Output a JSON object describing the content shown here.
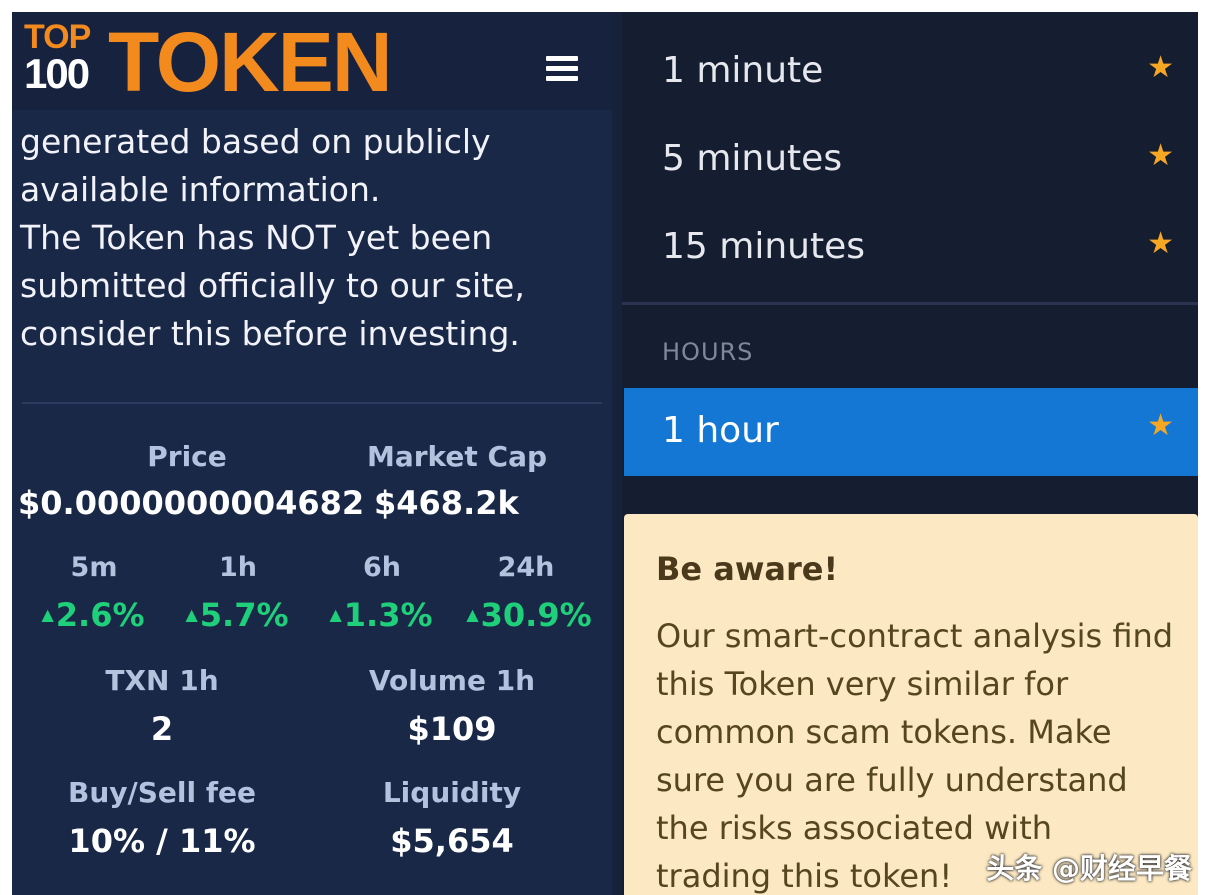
{
  "header": {
    "logo_top": "TOP",
    "logo_100": "100",
    "logo_token": "TOKEN"
  },
  "notice": {
    "text": "generated based on publicly available information.\nThe Token has NOT yet been submitted officially to our site, consider this before investing."
  },
  "stats": {
    "price_label": "Price",
    "price_value": "$0.0000000004682",
    "market_cap_label": "Market Cap",
    "market_cap_value": "$468.2k",
    "changes": [
      {
        "label": "5m",
        "value": "2.6%"
      },
      {
        "label": "1h",
        "value": "5.7%"
      },
      {
        "label": "6h",
        "value": "1.3%"
      },
      {
        "label": "24h",
        "value": "30.9%"
      }
    ],
    "txn_label": "TXN 1h",
    "txn_value": "2",
    "volume_label": "Volume 1h",
    "volume_value": "$109",
    "fee_label": "Buy/Sell fee",
    "fee_value": "10% / 11%",
    "liquidity_label": "Liquidity",
    "liquidity_value": "$5,654"
  },
  "timeframes": {
    "minutes": [
      {
        "label": "1 minute"
      },
      {
        "label": "5 minutes"
      },
      {
        "label": "15 minutes"
      }
    ],
    "hours_heading": "HOURS",
    "hours": [
      {
        "label": "1 hour",
        "selected": true
      }
    ]
  },
  "warning": {
    "title": "Be aware!",
    "body": "Our smart-contract analysis find this Token very similar for common scam tokens. Make sure you are fully understand the risks associated with trading this token!"
  },
  "watermark": "头条 @财经早餐",
  "colors": {
    "brand_orange": "#f28a1e",
    "positive_green": "#1fd07a",
    "selected_blue": "#1477d4",
    "star_gold": "#f5a623",
    "warning_bg": "#fce9c3"
  },
  "icons": {
    "menu": "hamburger-menu-icon",
    "favorite": "star-icon",
    "up": "triangle-up-icon"
  }
}
